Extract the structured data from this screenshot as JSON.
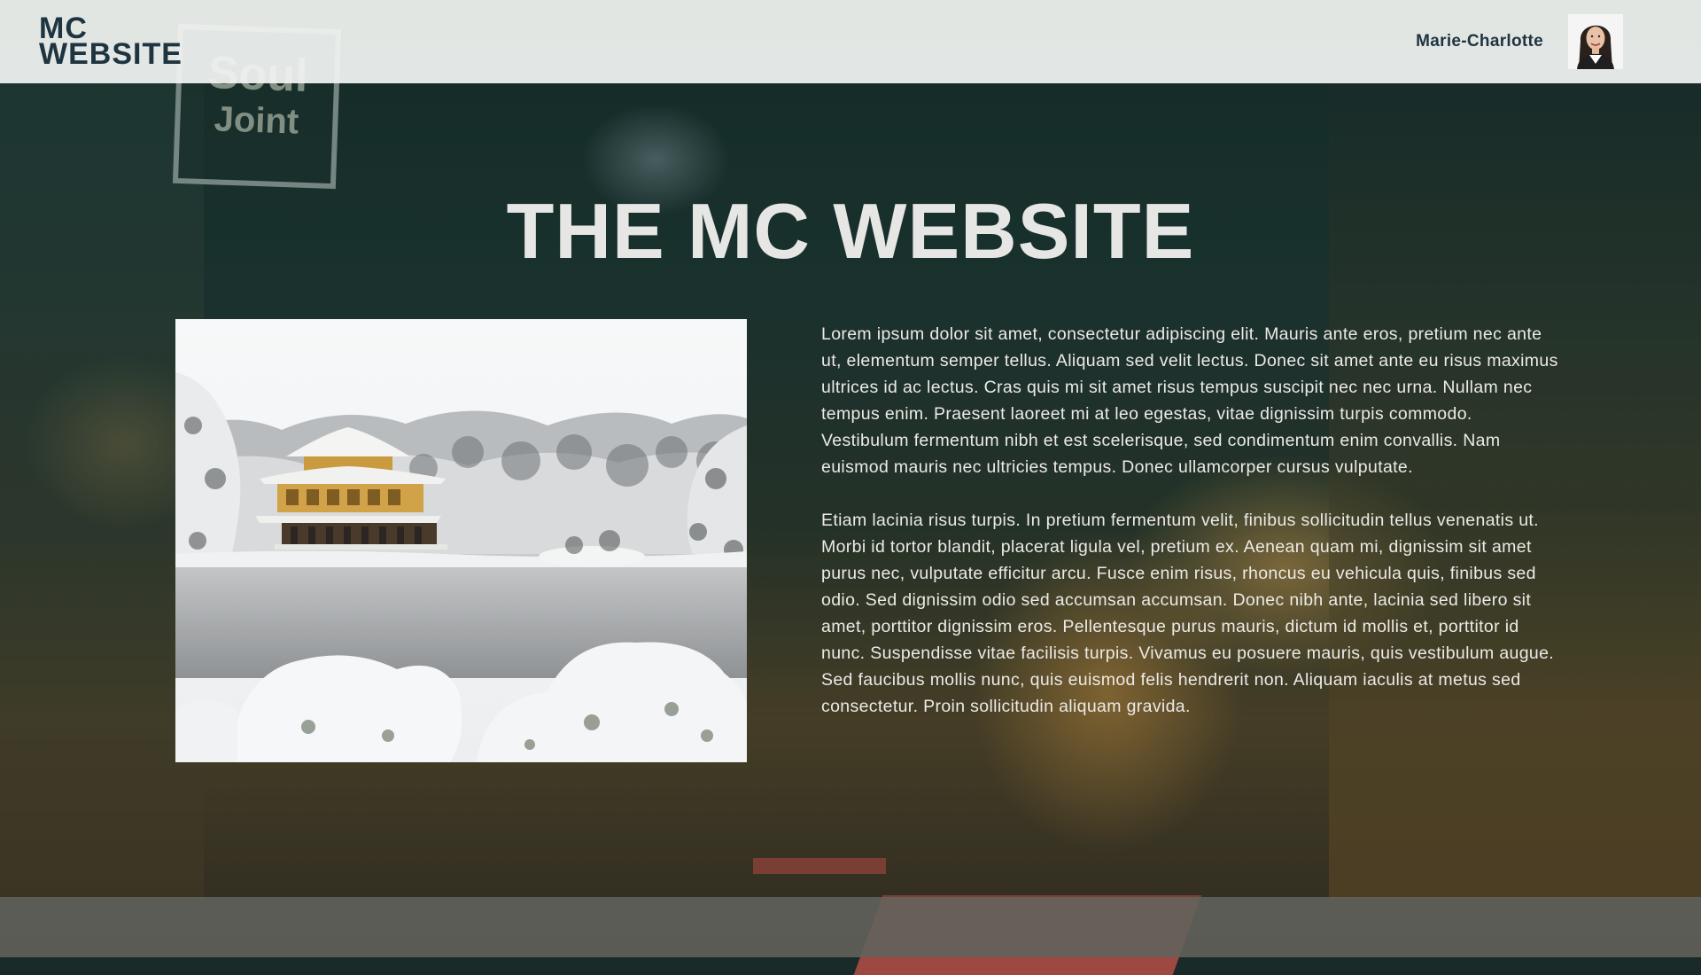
{
  "header": {
    "logo_line1": "MC",
    "logo_line2": "WEBSITE",
    "user_name": "Marie-Charlotte"
  },
  "hero": {
    "title": "THE MC WEBSITE"
  },
  "background_sign": {
    "line1": "Soul",
    "line2": "Joint"
  },
  "content": {
    "paragraphs": [
      "Lorem ipsum dolor sit amet, consectetur adipiscing elit. Mauris ante eros, pretium nec ante ut, elementum semper tellus. Aliquam sed velit lectus. Donec sit amet ante eu risus maximus ultrices id ac lectus. Cras quis mi sit amet risus tempus suscipit nec nec urna. Nullam nec tempus enim. Praesent laoreet mi at leo egestas, vitae dignissim turpis commodo. Vestibulum fermentum nibh et est scelerisque, sed condimentum enim convallis. Nam euismod mauris nec ultricies tempus. Donec ullamcorper cursus vulputate.",
      "Etiam lacinia risus turpis. In pretium fermentum velit, finibus sollicitudin tellus venenatis ut. Morbi id tortor blandit, placerat ligula vel, pretium ex. Aenean quam mi, dignissim sit amet purus nec, vulputate efficitur arcu. Fusce enim risus, rhoncus eu vehicula quis, finibus sed odio. Sed dignissim odio sed accumsan accumsan. Donec nibh ante, lacinia sed libero sit amet, porttitor dignissim eros. Pellentesque purus mauris, dictum id mollis et, porttitor id nunc. Suspendisse vitae facilisis turpis. Vivamus eu posuere mauris, quis vestibulum augue. Sed faucibus mollis nunc, quis euismod felis hendrerit non. Aliquam iaculis at metus sed consectetur. Proin sollicitudin aliquam gravida."
    ]
  },
  "colors": {
    "header_bg": "#f2f4f2",
    "logo_text": "#1e3440",
    "title_text": "#e6e6e4",
    "body_text": "#eceae6",
    "footer_bg": "#64665f"
  }
}
